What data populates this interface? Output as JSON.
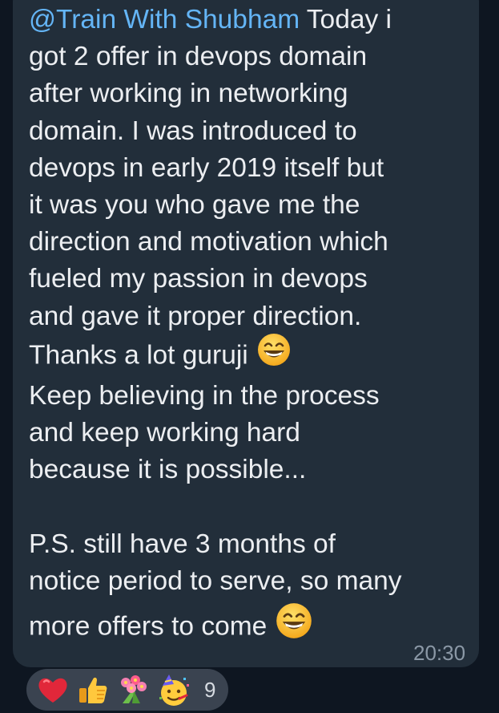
{
  "message": {
    "mention": "@Train With Shubham",
    "first_line_rest": " Today i",
    "lines": [
      "got 2 offer in devops domain",
      "after working in networking",
      "domain. I was introduced to",
      "devops in early 2019 itself but",
      "it was you who gave me the",
      "direction and motivation which",
      "fueled my passion in devops",
      "and gave it proper direction."
    ],
    "thanks_line": "Thanks a lot guruji",
    "believing_lines": [
      "Keep  believing in the process",
      "and keep working hard",
      "because it is possible..."
    ],
    "ps_lines": [
      "P.S. still have 3 months of",
      "notice period to serve, so many"
    ],
    "last_line": "more offers to come",
    "emoji": "grinning-face-with-smiling-eyes",
    "time": "20:30"
  },
  "reactions": {
    "items": [
      "red-heart",
      "thumbs-up",
      "bouquet",
      "partying-face"
    ],
    "count": "9"
  },
  "colors": {
    "background": "#0e1621",
    "bubble": "#222e3a",
    "text": "#eceef1",
    "mention": "#64b5f6",
    "time": "#8b98a6",
    "reaction_pill": "#3a4350"
  }
}
